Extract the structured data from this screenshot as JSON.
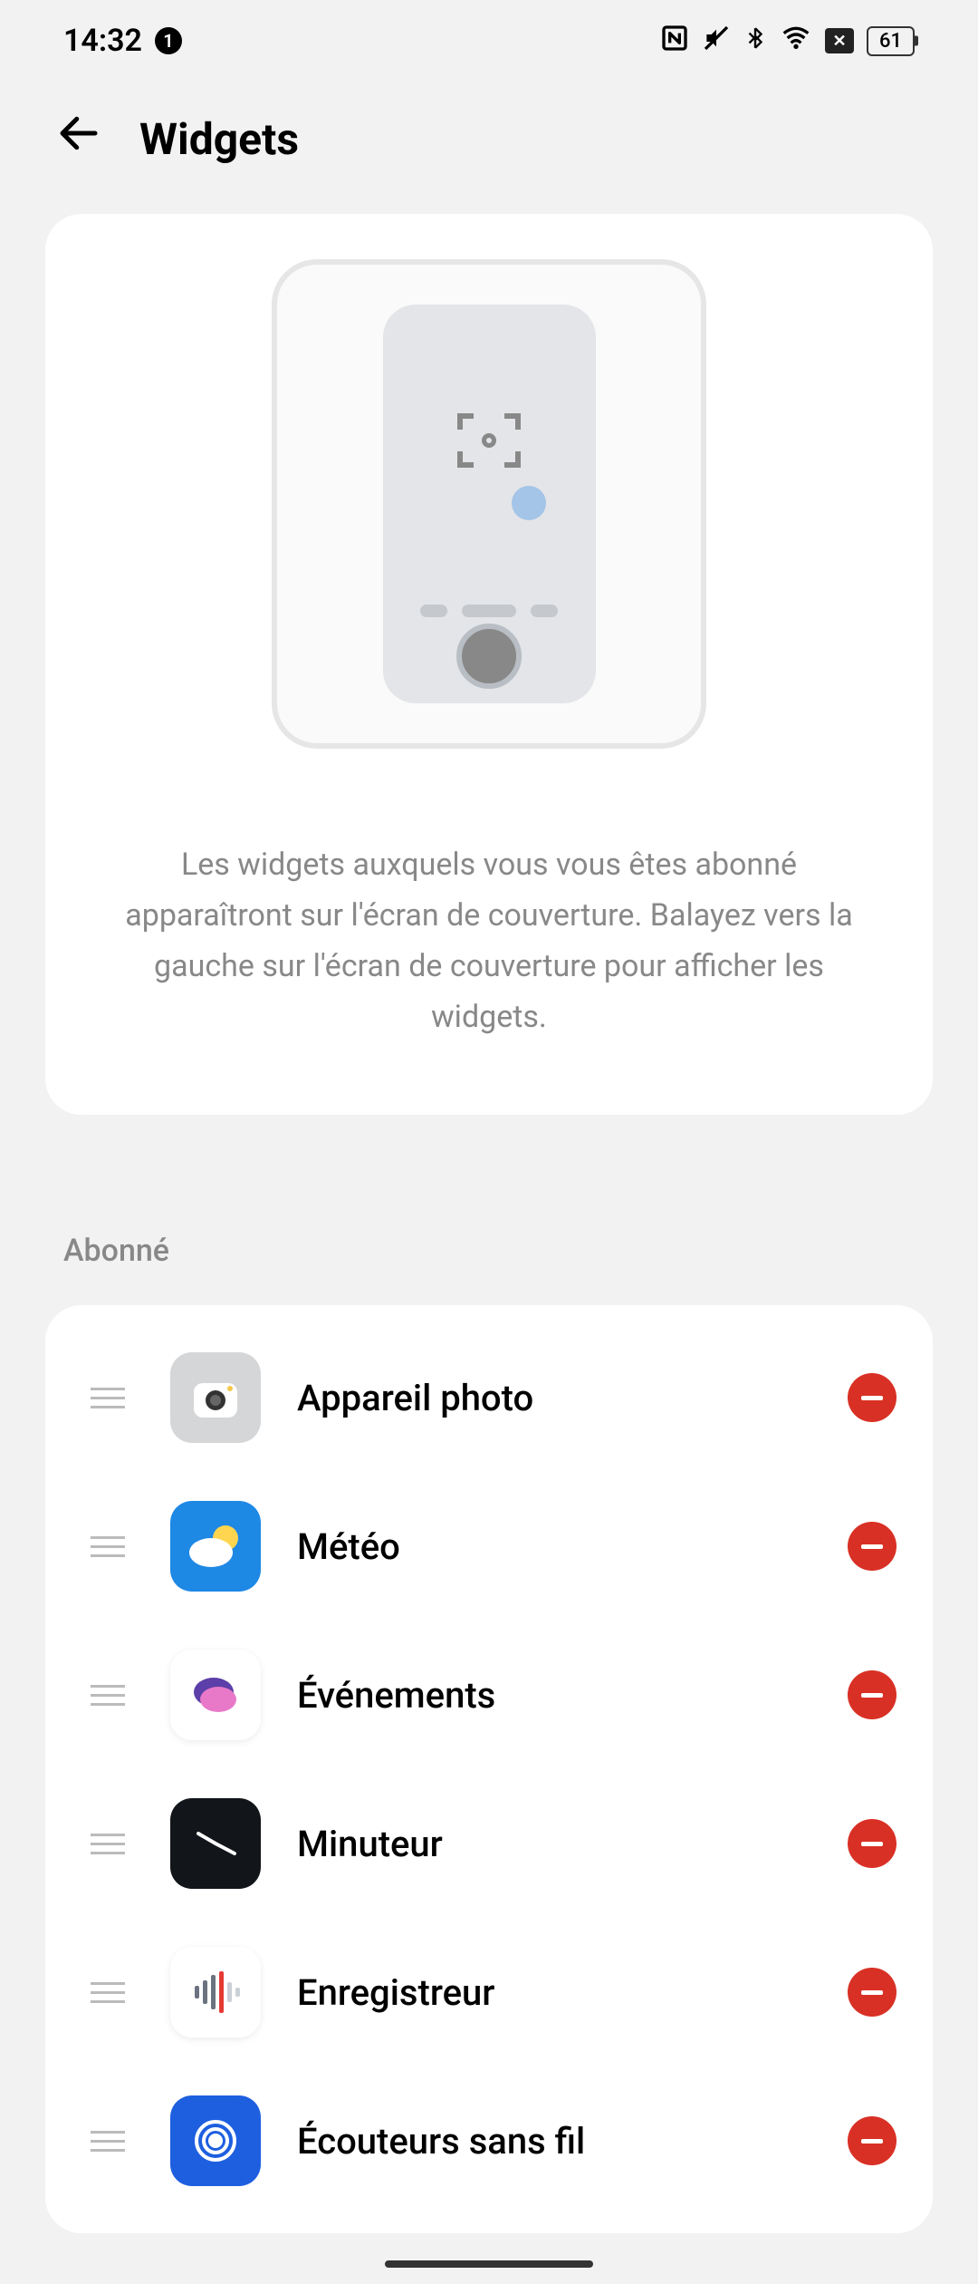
{
  "status": {
    "time": "14:32",
    "notification_count": "1",
    "battery": "61"
  },
  "header": {
    "title": "Widgets"
  },
  "intro": {
    "description": "Les widgets auxquels vous vous êtes abonné apparaîtront sur l'écran de couverture. Balayez vers la gauche sur l'écran de couverture pour afficher les widgets."
  },
  "section": {
    "subscribed_title": "Abonné"
  },
  "items": [
    {
      "label": "Appareil photo",
      "icon": "camera-icon"
    },
    {
      "label": "Météo",
      "icon": "weather-icon"
    },
    {
      "label": "Événements",
      "icon": "events-icon"
    },
    {
      "label": "Minuteur",
      "icon": "timer-icon"
    },
    {
      "label": "Enregistreur",
      "icon": "recorder-icon"
    },
    {
      "label": "Écouteurs sans fil",
      "icon": "earbuds-icon"
    }
  ]
}
